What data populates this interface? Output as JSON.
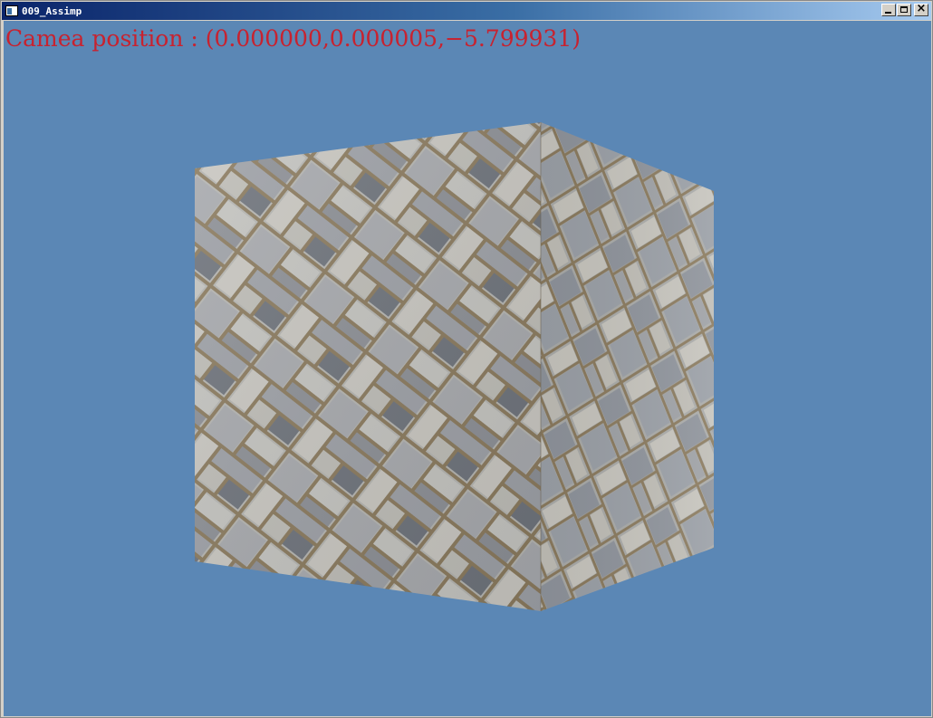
{
  "window": {
    "title": "009_Assimp",
    "icon": "app-window-icon",
    "buttons": {
      "minimize": "minimize-icon",
      "maximize": "maximize-icon",
      "close": "×"
    }
  },
  "viewport": {
    "background_color": "#5b87b5",
    "camera_label": "Camea position : (0.000000,0.000005,−5.799931)",
    "camera_label_color": "#c8222f",
    "object": "textured-cube",
    "texture": "stone-tile"
  }
}
